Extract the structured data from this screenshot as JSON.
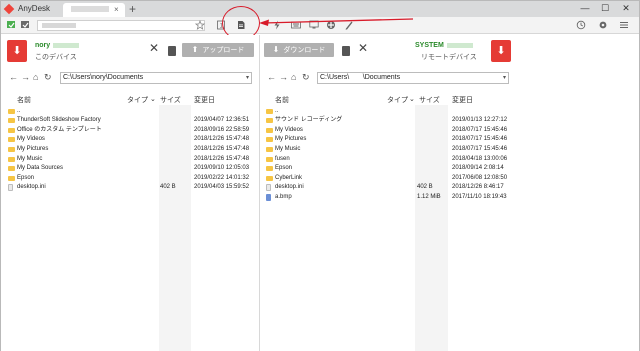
{
  "app": {
    "title": "AnyDesk",
    "new_tab": "+",
    "tab_close": "×"
  },
  "window_controls": {
    "minimize": "—",
    "maximize": "☐",
    "close": "✕"
  },
  "toolbar": {
    "address_icon": "monitor-icon",
    "tool_icons": [
      "monitor-icon",
      "chat-icon",
      "lightning-icon",
      "keyboard-icon",
      "display-icon",
      "actions-icon",
      "draw-icon"
    ],
    "right_icons": [
      "history-icon",
      "settings-icon",
      "menu-icon"
    ]
  },
  "left": {
    "user": "nory",
    "desc": "このデバイス",
    "transfer_label": "アップロード",
    "path": "C:\\Users\\nory\\Documents",
    "columns": {
      "name": "名前",
      "type": "タイプ",
      "size": "サイズ",
      "date": "変更日"
    },
    "files": [
      {
        "name": "..",
        "kind": "folder",
        "size": "",
        "date": ""
      },
      {
        "name": "ThunderSoft Slideshow Factory",
        "kind": "folder",
        "size": "",
        "date": "2019/04/07 12:36:51"
      },
      {
        "name": "Office のカスタム テンプレート",
        "kind": "folder",
        "size": "",
        "date": "2018/09/16 22:58:59"
      },
      {
        "name": "My Videos",
        "kind": "folder",
        "size": "",
        "date": "2018/12/26 15:47:48"
      },
      {
        "name": "My Pictures",
        "kind": "folder",
        "size": "",
        "date": "2018/12/26 15:47:48"
      },
      {
        "name": "My Music",
        "kind": "folder",
        "size": "",
        "date": "2018/12/26 15:47:48"
      },
      {
        "name": "My Data Sources",
        "kind": "folder",
        "size": "",
        "date": "2019/09/10 12:05:03"
      },
      {
        "name": "Epson",
        "kind": "folder",
        "size": "",
        "date": "2019/02/22 14:01:32"
      },
      {
        "name": "desktop.ini",
        "kind": "file",
        "size": "402 B",
        "date": "2019/04/03 15:59:52"
      }
    ]
  },
  "right": {
    "user": "SYSTEM",
    "desc": "リモートデバイス",
    "transfer_label": "ダウンロード",
    "path": "C:\\Users\\       \\Documents",
    "columns": {
      "name": "名前",
      "type": "タイプ",
      "size": "サイズ",
      "date": "変更日"
    },
    "files": [
      {
        "name": "..",
        "kind": "folder",
        "size": "",
        "date": ""
      },
      {
        "name": "サウンド レコーディング",
        "kind": "folder",
        "size": "",
        "date": "2019/01/13 12:27:12"
      },
      {
        "name": "My Videos",
        "kind": "folder",
        "size": "",
        "date": "2018/07/17 15:45:46"
      },
      {
        "name": "My Pictures",
        "kind": "folder",
        "size": "",
        "date": "2018/07/17 15:45:46"
      },
      {
        "name": "My Music",
        "kind": "folder",
        "size": "",
        "date": "2018/07/17 15:45:46"
      },
      {
        "name": "fusen",
        "kind": "folder",
        "size": "",
        "date": "2018/04/18 13:00:06"
      },
      {
        "name": "Epson",
        "kind": "folder",
        "size": "",
        "date": "2018/09/14 2:08:14"
      },
      {
        "name": "CyberLink",
        "kind": "folder",
        "size": "",
        "date": "2017/06/08 12:08:50"
      },
      {
        "name": "desktop.ini",
        "kind": "file",
        "size": "402 B",
        "date": "2018/12/26 8:46:17"
      },
      {
        "name": "a.bmp",
        "kind": "bmp",
        "size": "1.12 MiB",
        "date": "2017/11/10 18:19:43"
      }
    ]
  },
  "colors": {
    "accent_red": "#e53b35",
    "user_green": "#2a8a2a",
    "annotation_red": "#d81b2a",
    "folder_yellow": "#f6c544"
  }
}
